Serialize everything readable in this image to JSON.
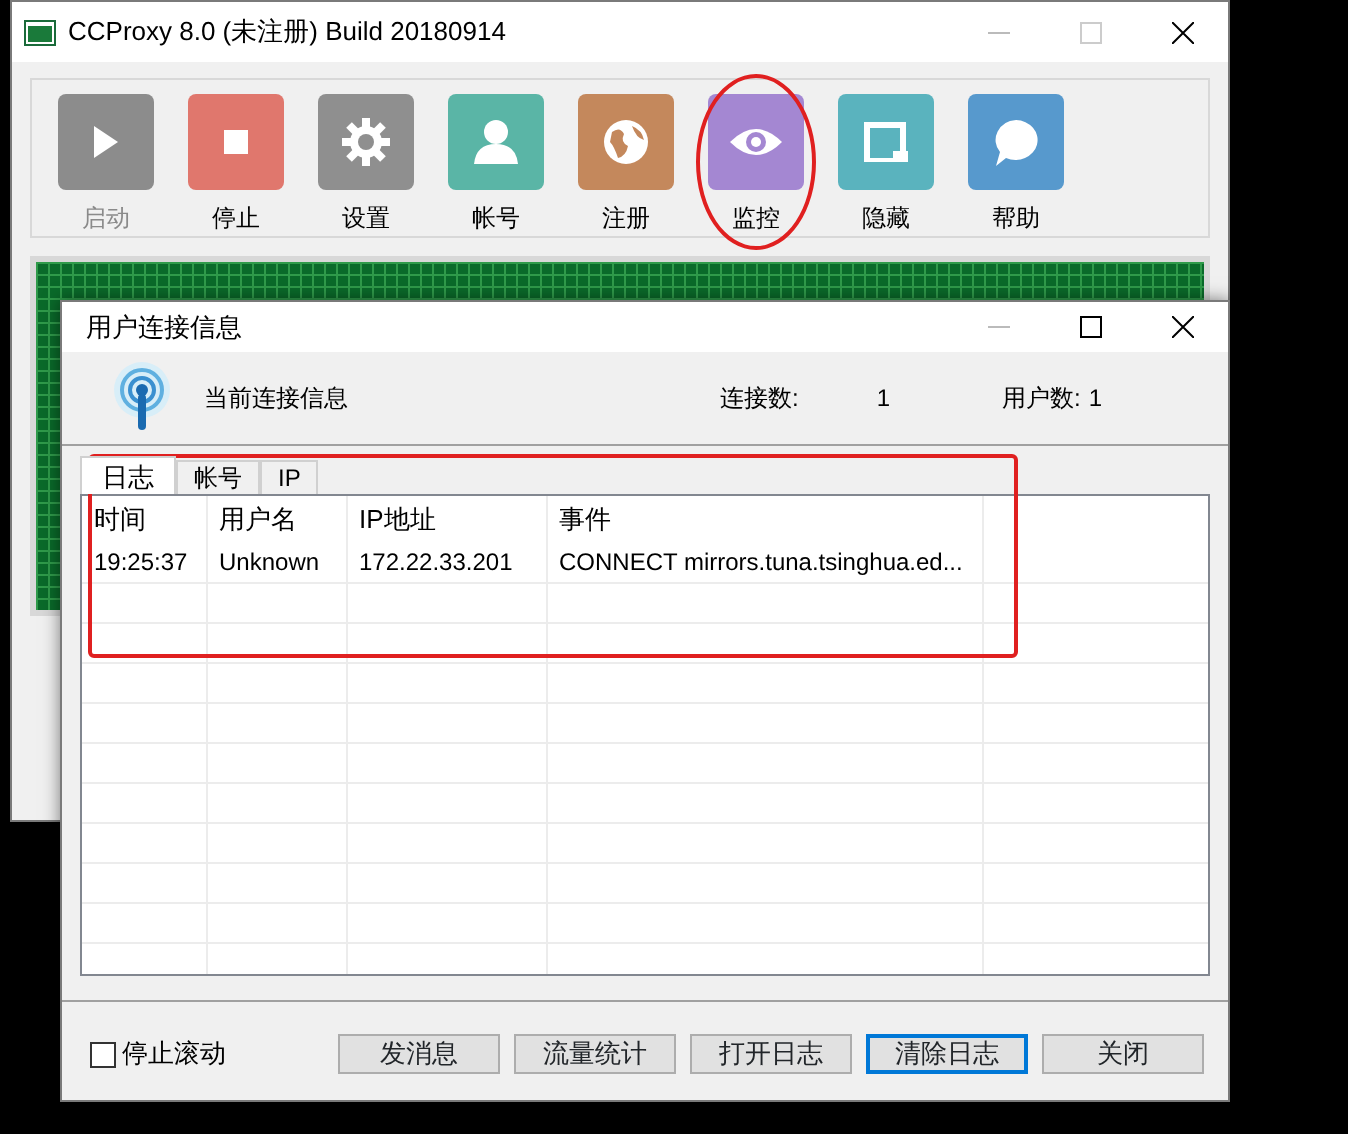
{
  "main_window": {
    "title": "CCProxy 8.0 (未注册) Build 20180914",
    "toolbar": [
      {
        "label": "启动",
        "kind": "play",
        "color": "#8c8c8c",
        "disabled": true,
        "circled": false
      },
      {
        "label": "停止",
        "kind": "stop",
        "color": "#e0776d",
        "disabled": false,
        "circled": false
      },
      {
        "label": "设置",
        "kind": "gear",
        "color": "#8f8f8f",
        "disabled": false,
        "circled": false
      },
      {
        "label": "帐号",
        "kind": "person",
        "color": "#5ab5a6",
        "disabled": false,
        "circled": false
      },
      {
        "label": "注册",
        "kind": "globe",
        "color": "#c4885c",
        "disabled": false,
        "circled": false
      },
      {
        "label": "监控",
        "kind": "eye",
        "color": "#a487d2",
        "disabled": false,
        "circled": true
      },
      {
        "label": "隐藏",
        "kind": "window",
        "color": "#5ab3be",
        "disabled": false,
        "circled": false
      },
      {
        "label": "帮助",
        "kind": "help",
        "color": "#5799cd",
        "disabled": false,
        "circled": false
      }
    ]
  },
  "dialog": {
    "title": "用户连接信息",
    "header": {
      "caption": "当前连接信息",
      "connections_label": "连接数:",
      "connections": "1",
      "users_label": "用户数:",
      "users": "1"
    },
    "tabs": [
      {
        "label": "日志",
        "selected": true
      },
      {
        "label": "帐号",
        "selected": false
      },
      {
        "label": "IP",
        "selected": false
      }
    ],
    "table": {
      "outlined": true,
      "columns": [
        "时间",
        "用户名",
        "IP地址",
        "事件"
      ],
      "rows": [
        [
          "19:25:37",
          "Unknown",
          "172.22.33.201",
          "CONNECT mirrors.tuna.tsinghua.ed..."
        ]
      ]
    },
    "stop_scroll": {
      "label": "停止滚动",
      "checked": false
    },
    "buttons": [
      {
        "label": "发消息",
        "focused": false
      },
      {
        "label": "流量统计",
        "focused": false
      },
      {
        "label": "打开日志",
        "focused": false
      },
      {
        "label": "清除日志",
        "focused": true
      },
      {
        "label": "关闭",
        "focused": false
      }
    ]
  }
}
